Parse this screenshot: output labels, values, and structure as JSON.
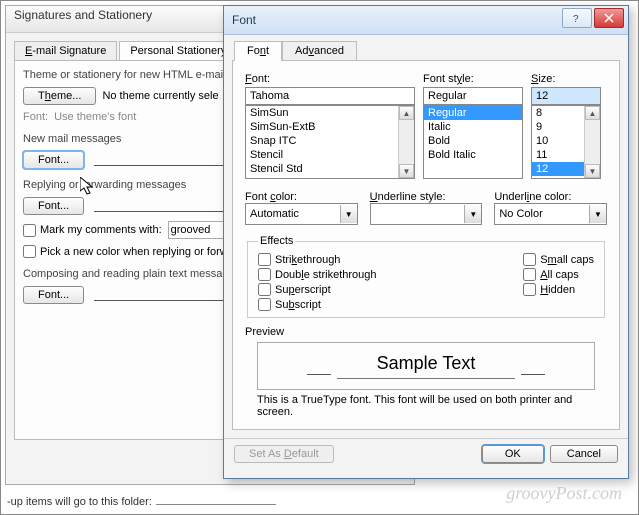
{
  "back": {
    "title": "Signatures and Stationery",
    "tabs": {
      "email": "E-mail Signature",
      "stationery": "Personal Stationery"
    },
    "themeLine": "Theme or stationery for new HTML e-mail m",
    "themeBtn": "Theme...",
    "noTheme": "No theme currently sele",
    "fontLabel": "Font:",
    "useThemeFont": "Use theme's font",
    "newMail": "New mail messages",
    "fontBtn": "Font...",
    "replyFwd": "Replying or forwarding messages",
    "markComments": "Mark my comments with:",
    "markValue": "grooved",
    "pickColor": "Pick a new color when replying or forw",
    "composing": "Composing and reading plain text message",
    "footer": "-up items will go to this folder:"
  },
  "font": {
    "title": "Font",
    "tabs": {
      "font": "Font",
      "advanced": "Advanced"
    },
    "labels": {
      "font": "Font:",
      "style": "Font style:",
      "size": "Size:",
      "color": "Font color:",
      "uline": "Underline style:",
      "ucolor": "Underline color:"
    },
    "fontValue": "Tahoma",
    "fontList": [
      "SimSun",
      "SimSun-ExtB",
      "Snap ITC",
      "Stencil",
      "Stencil Std"
    ],
    "styleValue": "Regular",
    "styleList": [
      "Regular",
      "Italic",
      "Bold",
      "Bold Italic"
    ],
    "sizeValue": "12",
    "sizeList": [
      "8",
      "9",
      "10",
      "11",
      "12"
    ],
    "colorValue": "Automatic",
    "ulineValue": "",
    "ucolorValue": "No Color",
    "effectsTitle": "Effects",
    "effects": {
      "strike": "Strikethrough",
      "dstrike": "Double strikethrough",
      "super": "Superscript",
      "sub": "Subscript",
      "smallcaps": "Small caps",
      "allcaps": "All caps",
      "hidden": "Hidden"
    },
    "previewLabel": "Preview",
    "previewText": "Sample Text",
    "previewNote": "This is a TrueType font. This font will be used on both printer and screen.",
    "setDefault": "Set As Default",
    "ok": "OK",
    "cancel": "Cancel"
  },
  "watermark": "groovyPost.com"
}
